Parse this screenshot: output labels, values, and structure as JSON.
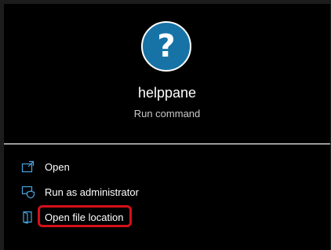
{
  "app": {
    "name": "helppane",
    "subtitle": "Run command",
    "icon": "question-mark-icon",
    "icon_glyph": "?",
    "icon_color": "#1773a6"
  },
  "actions": [
    {
      "label": "Open",
      "icon": "open-window-icon"
    },
    {
      "label": "Run as administrator",
      "icon": "shield-icon"
    },
    {
      "label": "Open file location",
      "icon": "folder-icon"
    }
  ],
  "colors": {
    "accent": "#4aa3df",
    "highlight": "#d4101a",
    "background": "#000000"
  }
}
